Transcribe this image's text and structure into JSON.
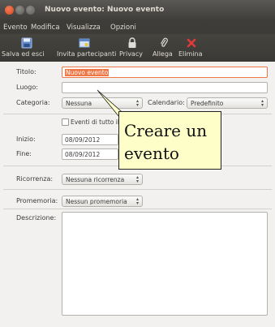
{
  "window": {
    "title": "Nuovo evento: Nuovo evento"
  },
  "menu": {
    "items": [
      "Evento",
      "Modifica",
      "Visualizza",
      "Opzioni"
    ]
  },
  "toolbar": {
    "save": "Salva ed esci",
    "invite": "Invita partecipanti",
    "privacy": "Privacy",
    "attach": "Allega",
    "delete": "Elimina"
  },
  "form": {
    "title_label": "Titolo:",
    "title_value": "Nuovo evento",
    "location_label": "Luogo:",
    "location_value": "",
    "category_label": "Categoria:",
    "category_value": "Nessuna",
    "calendar_label": "Calendario:",
    "calendar_value": "Predefinito",
    "allday_label": "Eventi di tutto il giorno",
    "start_label": "Inizio:",
    "start_value": "08/09/2012",
    "end_label": "Fine:",
    "end_value": "08/09/2012",
    "repeat_label": "Ricorrenza:",
    "repeat_value": "Nessuna ricorrenza",
    "reminder_label": "Promemoria:",
    "reminder_value": "Nessun promemoria",
    "description_label": "Descrizione:",
    "description_value": ""
  },
  "callout": {
    "line1": "Creare un",
    "line2": "evento"
  }
}
